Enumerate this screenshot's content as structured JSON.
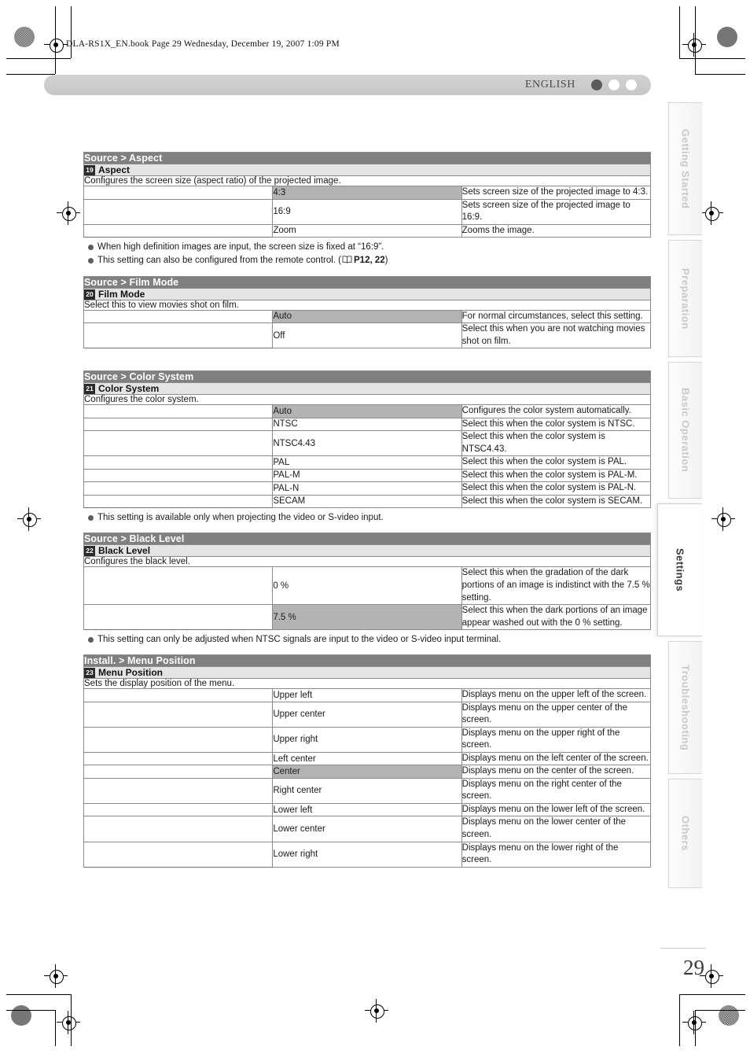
{
  "file_header": "DLA-RS1X_EN.book  Page 29  Wednesday, December 19, 2007  1:09 PM",
  "header_bar": {
    "language": "ENGLISH",
    "indicators": [
      "filled",
      "hollow",
      "hollow"
    ]
  },
  "page_number": "29",
  "side_tabs": [
    {
      "label": "Getting Started",
      "active": false
    },
    {
      "label": "Preparation",
      "active": false
    },
    {
      "label": "Basic Operation",
      "active": false
    },
    {
      "label": "Settings",
      "active": true
    },
    {
      "label": "Troubleshooting",
      "active": false
    },
    {
      "label": "Others",
      "active": false
    }
  ],
  "sections": [
    {
      "heading": "Source > Aspect",
      "badge": "19",
      "sub_heading": "Aspect",
      "description": "Configures the screen size (aspect ratio) of the projected image.",
      "rows": [
        {
          "name": "4:3",
          "desc": "Sets screen size of the projected image to 4:3.",
          "highlight": true
        },
        {
          "name": "16:9",
          "desc": "Sets screen size of the projected image to 16:9.",
          "highlight": false
        },
        {
          "name": "Zoom",
          "desc": "Zooms the image.",
          "highlight": false
        }
      ],
      "notes": [
        {
          "text": "When high definition images are input, the screen size is fixed at “16:9”.",
          "ref": null
        },
        {
          "text": "This setting can also be configured from the remote control. (",
          "ref": "P12, 22",
          "tail": ")"
        }
      ]
    },
    {
      "heading": "Source > Film Mode",
      "badge": "20",
      "sub_heading": "Film Mode",
      "description": "Select this to view movies shot on film.",
      "rows": [
        {
          "name": "Auto",
          "desc": "For normal circumstances, select this setting.",
          "highlight": true
        },
        {
          "name": "Off",
          "desc": "Select this when you are not watching movies shot on film.",
          "highlight": false
        }
      ],
      "notes": []
    },
    {
      "heading": "Source > Color System",
      "badge": "21",
      "sub_heading": "Color System",
      "description": "Configures the color system.",
      "rows": [
        {
          "name": "Auto",
          "desc": "Configures the color system automatically.",
          "highlight": true
        },
        {
          "name": "NTSC",
          "desc": "Select this when the color system is NTSC.",
          "highlight": false
        },
        {
          "name": "NTSC4.43",
          "desc": "Select this when the color system is NTSC4.43.",
          "highlight": false
        },
        {
          "name": "PAL",
          "desc": "Select this when the color system is PAL.",
          "highlight": false
        },
        {
          "name": "PAL-M",
          "desc": "Select this when the color system is PAL-M.",
          "highlight": false
        },
        {
          "name": "PAL-N",
          "desc": "Select this when the color system is PAL-N.",
          "highlight": false
        },
        {
          "name": "SECAM",
          "desc": "Select this when the color system is SECAM.",
          "highlight": false
        }
      ],
      "notes": [
        {
          "text": "This setting is available only when projecting the video or S-video input.",
          "ref": null
        }
      ]
    },
    {
      "heading": "Source > Black Level",
      "badge": "22",
      "sub_heading": "Black Level",
      "description": "Configures the black level.",
      "rows": [
        {
          "name": "0 %",
          "desc": "Select this when the gradation of the dark portions of an image is indistinct with the 7.5 % setting.",
          "highlight": false
        },
        {
          "name": "7.5 %",
          "desc": "Select this when the dark portions of an image appear washed out with the 0 % setting.",
          "highlight": true
        }
      ],
      "notes": [
        {
          "text": "This setting can only be adjusted when NTSC signals are input to the video or S-video input terminal.",
          "ref": null
        }
      ]
    },
    {
      "heading": "Install. > Menu Position",
      "badge": "23",
      "sub_heading": "Menu Position",
      "description": "Sets the display position of the menu.",
      "rows": [
        {
          "name": "Upper left",
          "desc": "Displays menu on the upper left of the screen.",
          "highlight": false
        },
        {
          "name": "Upper center",
          "desc": "Displays menu on the upper center of the screen.",
          "highlight": false
        },
        {
          "name": "Upper right",
          "desc": "Displays menu on the upper right of the screen.",
          "highlight": false
        },
        {
          "name": "Left center",
          "desc": "Displays menu on the left center of the screen.",
          "highlight": false
        },
        {
          "name": "Center",
          "desc": "Displays menu on the center of the screen.",
          "highlight": true
        },
        {
          "name": "Right center",
          "desc": "Displays menu on the right center of the screen.",
          "highlight": false
        },
        {
          "name": "Lower left",
          "desc": "Displays menu on the lower left of the screen.",
          "highlight": false
        },
        {
          "name": "Lower center",
          "desc": "Displays menu on the lower center of the screen.",
          "highlight": false
        },
        {
          "name": "Lower right",
          "desc": "Displays menu on the lower right of the screen.",
          "highlight": false
        }
      ],
      "notes": []
    }
  ]
}
